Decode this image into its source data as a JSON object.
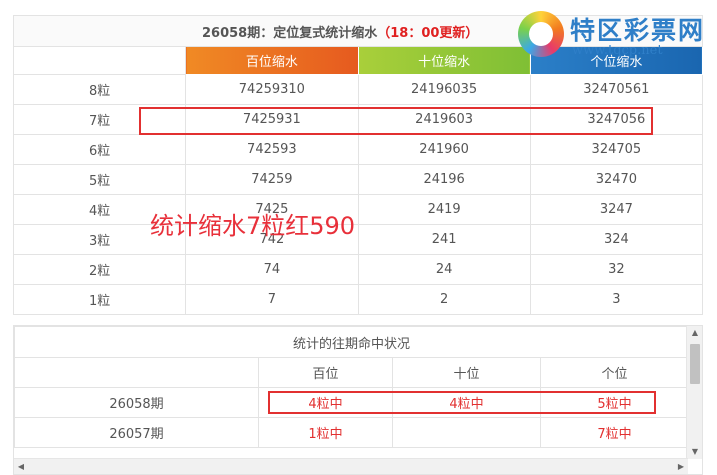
{
  "stats": {
    "title_main": "26058期：定位复式统计缩水",
    "title_update": "（18：00更新）",
    "headers": [
      "百位缩水",
      "十位缩水",
      "个位缩水"
    ],
    "colors": {
      "orange": "#e65a1f",
      "green": "#7fbf35",
      "blue": "#1a66b0",
      "highlight": "#e23030"
    },
    "rows": [
      {
        "label": "8粒",
        "values": [
          "74259310",
          "24196035",
          "32470561"
        ]
      },
      {
        "label": "7粒",
        "values": [
          "7425931",
          "2419603",
          "3247056"
        ]
      },
      {
        "label": "6粒",
        "values": [
          "742593",
          "241960",
          "324705"
        ]
      },
      {
        "label": "5粒",
        "values": [
          "74259",
          "24196",
          "32470"
        ]
      },
      {
        "label": "4粒",
        "values": [
          "7425",
          "2419",
          "3247"
        ]
      },
      {
        "label": "3粒",
        "values": [
          "742",
          "241",
          "324"
        ]
      },
      {
        "label": "2粒",
        "values": [
          "74",
          "24",
          "32"
        ]
      },
      {
        "label": "1粒",
        "values": [
          "7",
          "2",
          "3"
        ]
      }
    ]
  },
  "overlay": {
    "annotation": "统计缩水7粒红590"
  },
  "logo": {
    "name": "特区彩票网",
    "url": "www.tqcp.net",
    "icon": "lottery-swirl-icon"
  },
  "history": {
    "caption": "统计的往期命中状况",
    "headers": [
      "",
      "百位",
      "十位",
      "个位"
    ],
    "rows": [
      {
        "period": "26058期",
        "cells": [
          "4粒中",
          "4粒中",
          "5粒中"
        ]
      },
      {
        "period": "26057期",
        "cells": [
          "1粒中",
          "",
          "7粒中"
        ]
      }
    ]
  },
  "scrollbar": {
    "up_icon": "▲",
    "down_icon": "▼",
    "left_icon": "◀",
    "right_icon": "▶"
  }
}
